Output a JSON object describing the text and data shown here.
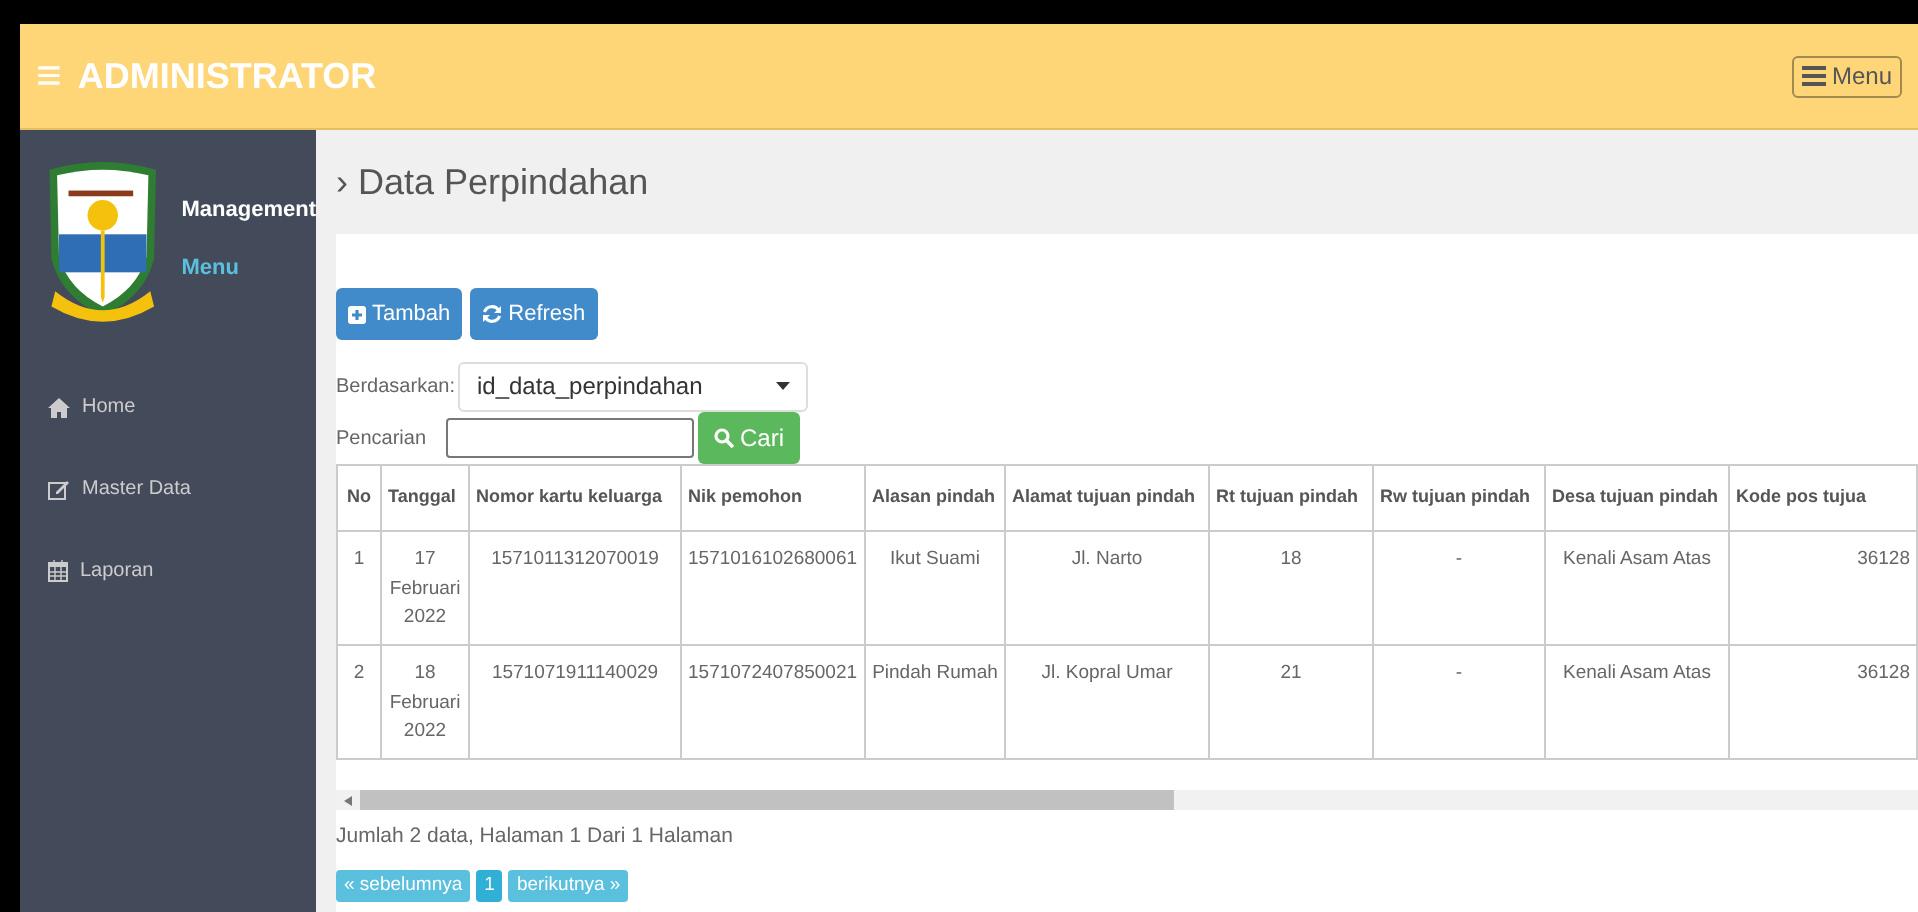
{
  "header": {
    "menu_glyph": "≡",
    "title": "ADMINISTRATOR",
    "menu_button": "Menu"
  },
  "sidebar": {
    "brand_line_1": "Management",
    "brand_line_2": "Menu",
    "items": [
      {
        "label": "Home"
      },
      {
        "label": "Master Data"
      },
      {
        "label": "Laporan"
      }
    ]
  },
  "page": {
    "caret": "›",
    "title": "Data Perpindahan"
  },
  "buttons": [
    {
      "label": "Tambah"
    },
    {
      "label": "Refresh"
    }
  ],
  "filter": {
    "by_label": "Berdasarkan:",
    "by_value": "id_data_perpindahan",
    "search_label": "Pencarian",
    "search_button": "Cari"
  },
  "table": {
    "columns": [
      "No",
      "Tanggal",
      "Nomor kartu keluarga",
      "Nik pemohon",
      "Alasan pindah",
      "Alamat tujuan pindah",
      "Rt tujuan pindah",
      "Rw tujuan pindah",
      "Desa tujuan pindah",
      "Kode pos tujua"
    ],
    "rows": [
      [
        "1",
        "17 Februari 2022",
        "1571011312070019",
        "1571016102680061",
        "Ikut Suami",
        "Jl. Narto",
        "18",
        "-",
        "Kenali Asam Atas",
        "36128"
      ],
      [
        "2",
        "18 Februari 2022",
        "1571071911140029",
        "1571072407850021",
        "Pindah Rumah",
        "Jl. Kopral Umar",
        "21",
        "-",
        "Kenali Asam Atas",
        "36128"
      ]
    ]
  },
  "summary": "Jumlah 2 data, Halaman 1 Dari 1 Halaman",
  "pagination": [
    {
      "label": "« sebelumnya",
      "selected": false
    },
    {
      "label": "1",
      "selected": true
    },
    {
      "label": "berikutnya »",
      "selected": false
    }
  ]
}
